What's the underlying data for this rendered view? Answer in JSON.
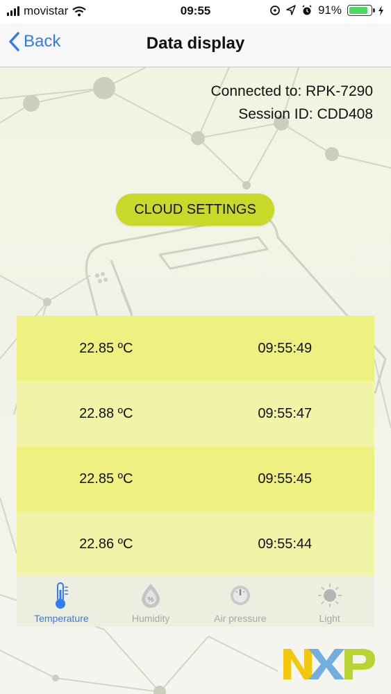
{
  "status_bar": {
    "carrier": "movistar",
    "time": "09:55",
    "battery_percent": "91%",
    "battery_level": 0.91
  },
  "nav": {
    "back_label": "Back",
    "title": "Data display"
  },
  "connection": {
    "connected_to": "Connected to: RPK-7290",
    "session_id": "Session ID: CDD408"
  },
  "cloud_button": {
    "label": "CLOUD SETTINGS"
  },
  "readings": [
    {
      "value": "22.85 ºC",
      "time": "09:55:49"
    },
    {
      "value": "22.88 ºC",
      "time": "09:55:47"
    },
    {
      "value": "22.85 ºC",
      "time": "09:55:45"
    },
    {
      "value": "22.86 ºC",
      "time": "09:55:44"
    }
  ],
  "tabs": [
    {
      "label": "Temperature",
      "icon": "thermometer-icon",
      "active": true
    },
    {
      "label": "Humidity",
      "icon": "humidity-drop-icon",
      "active": false
    },
    {
      "label": "Air pressure",
      "icon": "pressure-gauge-icon",
      "active": false
    },
    {
      "label": "Light",
      "icon": "sun-icon",
      "active": false
    }
  ],
  "colors": {
    "accent_blue": "#2f7cf6",
    "cloud_button": "#c9d92a",
    "row_odd": "#eef080",
    "row_even": "#f1f3a6",
    "nxp_yellow": "#f2c80f",
    "nxp_blue": "#74aee0",
    "nxp_green": "#b8d431"
  }
}
